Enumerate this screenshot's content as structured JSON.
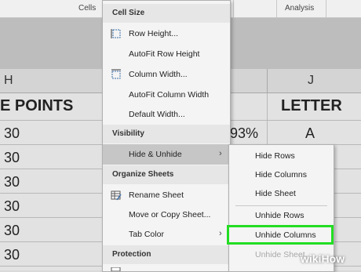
{
  "ribbon": {
    "cells_label": "Cells",
    "analysis_label": "Analysis"
  },
  "columns": {
    "h": "H",
    "j": "J"
  },
  "sheet": {
    "header_left": "E POINTS",
    "header_right": "LETTER",
    "percent": "93%",
    "grade": "A",
    "rows": [
      "30",
      "30",
      "30",
      "30",
      "30",
      "30"
    ]
  },
  "menu": {
    "cell_size": "Cell Size",
    "row_height": "Row Height...",
    "autofit_row": "AutoFit Row Height",
    "column_width": "Column Width...",
    "autofit_column": "AutoFit Column Width",
    "default_width": "Default Width...",
    "visibility": "Visibility",
    "hide_unhide": "Hide & Unhide",
    "organize": "Organize Sheets",
    "rename": "Rename Sheet",
    "move_copy": "Move or Copy Sheet...",
    "tab_color": "Tab Color",
    "protection": "Protection"
  },
  "submenu": {
    "hide_rows": "Hide Rows",
    "hide_columns": "Hide Columns",
    "hide_sheet": "Hide Sheet",
    "unhide_rows": "Unhide Rows",
    "unhide_columns": "Unhide Columns",
    "unhide_sheet": "Unhide Sheet..."
  },
  "highlight_color": "#22dd22",
  "watermark": {
    "wiki": "wiki",
    "how": "How"
  }
}
